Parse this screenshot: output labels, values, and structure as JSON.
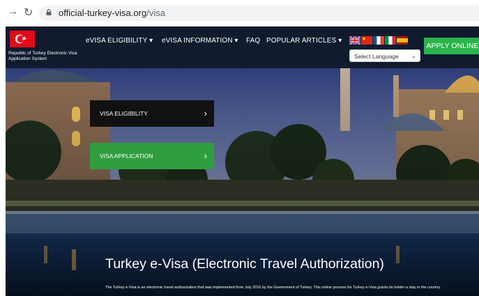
{
  "browser": {
    "url_domain": "official-turkey-visa.org",
    "url_path": "/visa"
  },
  "header": {
    "brand_line1": "Republic of Turkey Electronic Visa",
    "brand_line2": "Application System",
    "nav": [
      {
        "label": "eVISA ELIGIBILITY"
      },
      {
        "label": "eVISA INFORMATION"
      },
      {
        "label": "FAQ"
      },
      {
        "label": "POPULAR ARTICLES"
      }
    ],
    "language_select": "Select Language",
    "apply_label": "APPLY ONLINE"
  },
  "hero": {
    "buttons": [
      {
        "label": "VISA ELIGIBILITY"
      },
      {
        "label": "VISA APPLICATION"
      }
    ],
    "title": "Turkey e-Visa (Electronic Travel Authorization)",
    "description": "The Turkey e-Visa is an electronic travel authorization that was implemented from July 2016 by the Government of Turkey. This online process for Turkey e-Visa grants its holder a stay in the country."
  },
  "colors": {
    "header_bg": "#101b2e",
    "apply_green": "#2bb44a",
    "eligibility_btn": "#111111",
    "application_btn": "#2f9e3f",
    "turkey_red": "#e30a17"
  },
  "icons": [
    "back-arrow-icon",
    "reload-icon",
    "lock-icon",
    "dropdown-caret-icon",
    "chevron-right-icon",
    "uk-flag-icon",
    "china-flag-icon",
    "france-flag-icon",
    "italy-flag-icon",
    "spain-flag-icon"
  ]
}
